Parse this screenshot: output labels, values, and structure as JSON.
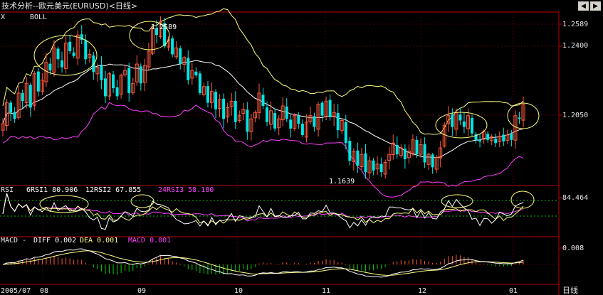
{
  "title": "技术分析--欧元美元(EURUSD)<日线>",
  "toolbar": {
    "left_icon": "arrow-left-icon",
    "right_icon": "arrow-right-icon",
    "x_label": "X"
  },
  "colors": {
    "up": "#ff5a3c",
    "down": "#00e5e5",
    "grid": "#7a0000",
    "axis": "#c00000",
    "mid": "#ffffff",
    "upper": "#ffff80",
    "lower": "#ff40ff",
    "ellipse": "#ffff80"
  },
  "labels": {
    "high_val": "1.2589",
    "low_val": "1.1639",
    "x_corner": "2005/07"
  },
  "main_panel": {
    "indicator": "BOLL",
    "yticks": [
      "1.2589",
      "1.2400",
      "1.2050"
    ]
  },
  "rsi_panel": {
    "prefix": "RSI",
    "rsi1": "6RSI1 80.906",
    "rsi2": "12RSI2 67.855",
    "rsi3": "24RSI3 58.180",
    "ytick": "84.464"
  },
  "macd_panel": {
    "prefix": "MACD -",
    "diff": "DIFF 0.002",
    "dea": "DEA 0.001",
    "macd": "MACD 0.001",
    "ytick": "0.008"
  },
  "x_axis": {
    "ticks": [
      "08",
      "09",
      "10",
      "11",
      "12",
      "01"
    ],
    "unit": "日线"
  },
  "chart_data": {
    "type": "candlestick",
    "title": "技术分析--欧元美元(EURUSD)<日线>",
    "ylim": [
      1.158,
      1.262
    ],
    "annotations": [
      {
        "label": "1.2589",
        "value": 1.2589
      },
      {
        "label": "1.1639",
        "value": 1.1639
      }
    ],
    "months": [
      "08",
      "09",
      "10",
      "11",
      "12",
      "01"
    ],
    "close": [
      1.195,
      1.208,
      1.202,
      1.198,
      1.214,
      1.209,
      1.22,
      1.205,
      1.226,
      1.215,
      1.222,
      1.233,
      1.228,
      1.242,
      1.235,
      1.23,
      1.245,
      1.24,
      1.237,
      1.25,
      1.247,
      1.235,
      1.238,
      1.227,
      1.23,
      1.222,
      1.212,
      1.226,
      1.217,
      1.212,
      1.225,
      1.228,
      1.214,
      1.22,
      1.232,
      1.22,
      1.231,
      1.24,
      1.254,
      1.25,
      1.258,
      1.243,
      1.247,
      1.238,
      1.242,
      1.232,
      1.236,
      1.222,
      1.228,
      1.225,
      1.214,
      1.218,
      1.208,
      1.215,
      1.204,
      1.21,
      1.198,
      1.205,
      1.209,
      1.196,
      1.2,
      1.204,
      1.19,
      1.198,
      1.202,
      1.214,
      1.206,
      1.196,
      1.203,
      1.192,
      1.198,
      1.206,
      1.198,
      1.192,
      1.2,
      1.195,
      1.188,
      1.196,
      1.2,
      1.193,
      1.207,
      1.2,
      1.209,
      1.199,
      1.202,
      1.191,
      1.197,
      1.183,
      1.172,
      1.178,
      1.169,
      1.176,
      1.165,
      1.172,
      1.166,
      1.17,
      1.165,
      1.171,
      1.176,
      1.183,
      1.176,
      1.18,
      1.173,
      1.178,
      1.185,
      1.176,
      1.182,
      1.171,
      1.176,
      1.168,
      1.174,
      1.18,
      1.194,
      1.2,
      1.193,
      1.202,
      1.197,
      1.193,
      1.2,
      1.189,
      1.185,
      1.184,
      1.19,
      1.185,
      1.187,
      1.183,
      1.187,
      1.184,
      1.188,
      1.185,
      1.2,
      1.198,
      1.207
    ],
    "series": [
      {
        "name": "6RSI1",
        "last": 80.906
      },
      {
        "name": "12RSI2",
        "last": 67.855
      },
      {
        "name": "24RSI3",
        "last": 58.18
      },
      {
        "name": "DIFF",
        "last": 0.002
      },
      {
        "name": "DEA",
        "last": 0.001
      },
      {
        "name": "MACD",
        "last": 0.001
      }
    ]
  }
}
